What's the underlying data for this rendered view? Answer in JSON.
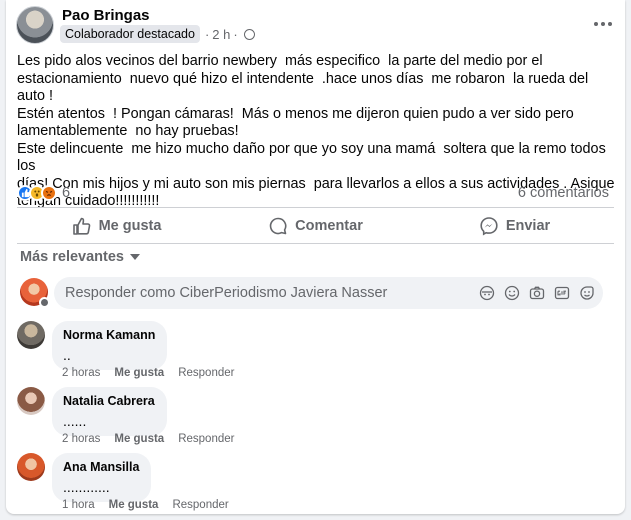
{
  "post": {
    "author": "Pao Bringas",
    "badge": "Colaborador destacado",
    "dot": "·",
    "time": "2 h",
    "meta_dot": "·",
    "text": "Les pido alos vecinos del barrio newbery  más especifico  la parte del medio por el\nestacionamiento  nuevo qué hizo el intendente  .hace unos días  me robaron  la rueda del auto !\nEstén atentos  ! Pongan cámaras!  Más o menos me dijeron quien pudo a ver sido pero\nlamentablemente  no hay pruebas!\nEste delincuente  me hizo mucho daño por que yo soy una mamá  soltera que la remo todos los\ndías! Con mis hijos y mi auto son mis piernas  para llevarlos a ellos a sus actividades . Asique\ntengan cuidado!!!!!!!!!!!",
    "reaction_count": "6",
    "comment_count": "6 comentarios",
    "reactions": [
      "like-icon",
      "wow-icon",
      "angry-icon"
    ]
  },
  "actions": {
    "like": "Me gusta",
    "comment": "Comentar",
    "share": "Enviar"
  },
  "sort_label": "Más relevantes",
  "composer": {
    "placeholder": "Responder como CiberPeriodismo Javiera Nasser",
    "icons": [
      "avatar-sticker-icon",
      "emoji-icon",
      "camera-icon",
      "gif-icon",
      "sticker-icon"
    ]
  },
  "comments": [
    {
      "name": "Norma Kamann",
      "text": "..",
      "time": "2 horas",
      "like": "Me gusta",
      "reply": "Responder"
    },
    {
      "name": "Natalia Cabrera",
      "text": "......",
      "time": "2 horas",
      "like": "Me gusta",
      "reply": "Responder"
    },
    {
      "name": "Ana Mansilla",
      "text": "............",
      "time": "1 hora",
      "like": "Me gusta",
      "reply": "Responder"
    }
  ],
  "colors": {
    "accent": "#1877f2",
    "secondary_text": "#65676b",
    "bubble": "#f0f2f5"
  }
}
